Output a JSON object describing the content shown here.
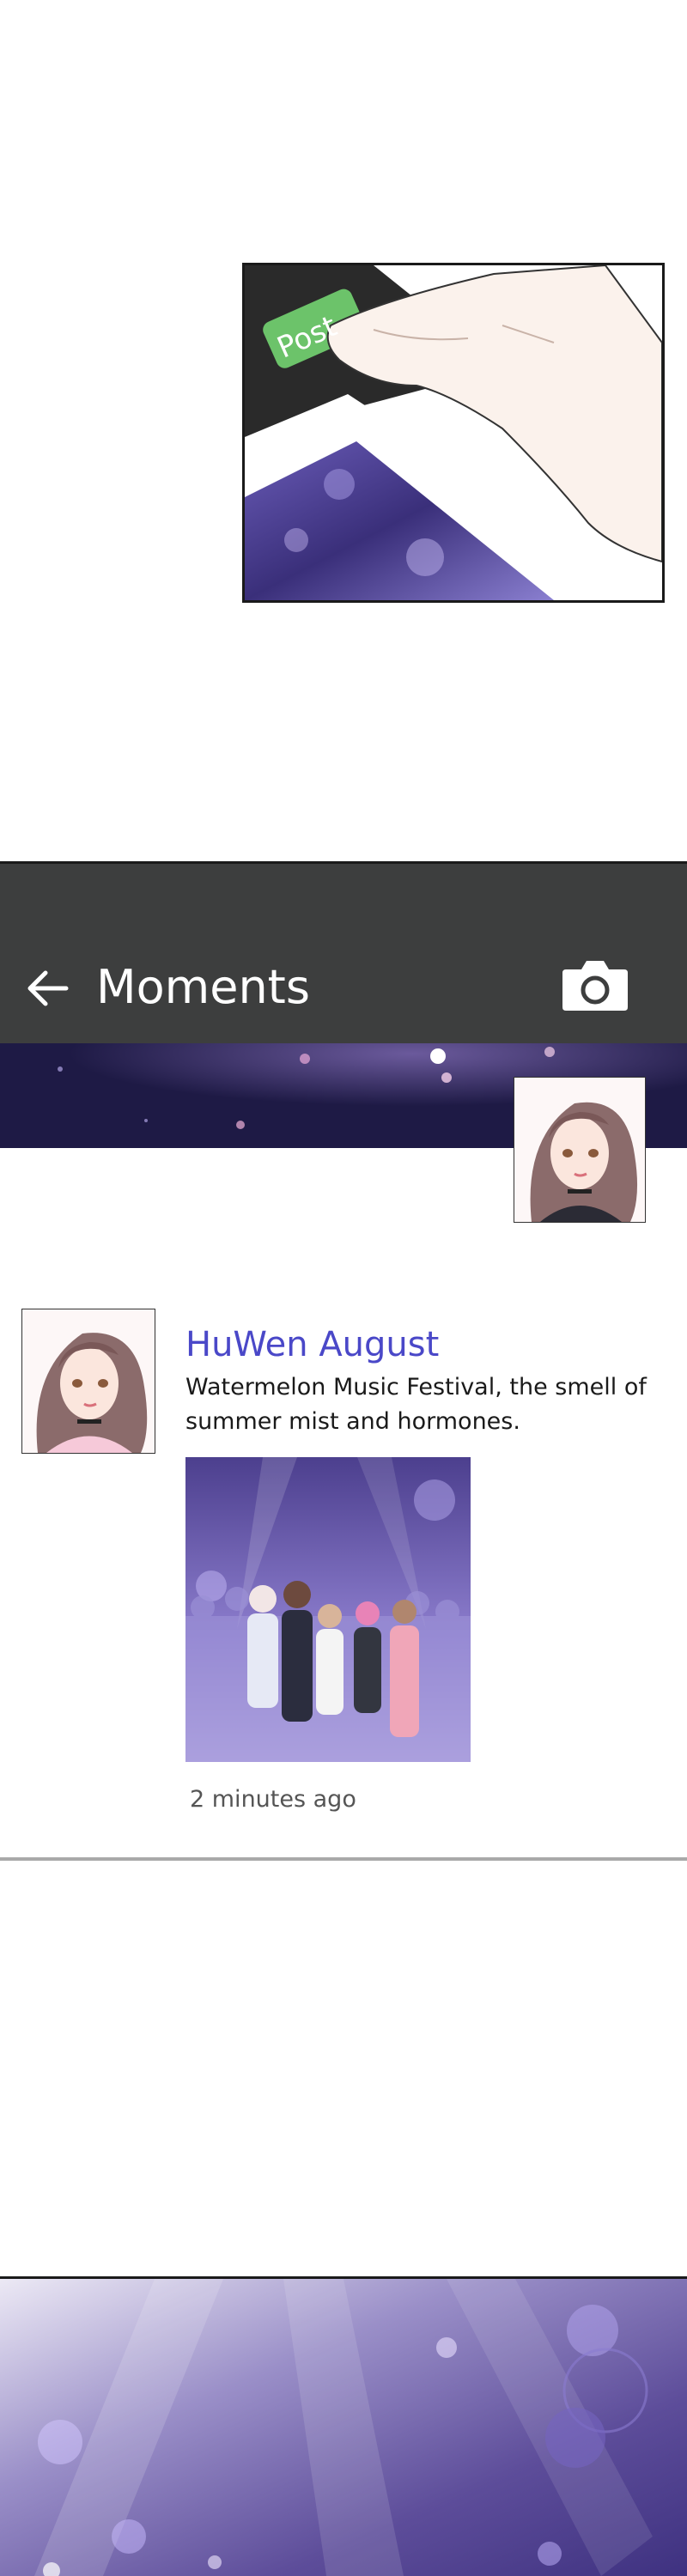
{
  "comic_panel": {
    "post_button_label": "Post",
    "post_button_color": "#6cc36a"
  },
  "app": {
    "header": {
      "title": "Moments",
      "back_icon": "arrow-left-icon",
      "camera_icon": "camera-icon",
      "background": "#3d3e3e"
    },
    "feed": {
      "posts": [
        {
          "author": "HuWen August",
          "text": "Watermelon Music Festival, the smell of summer mist and hormones.",
          "time": "2 minutes ago",
          "author_color": "#4a48c8"
        }
      ]
    }
  }
}
